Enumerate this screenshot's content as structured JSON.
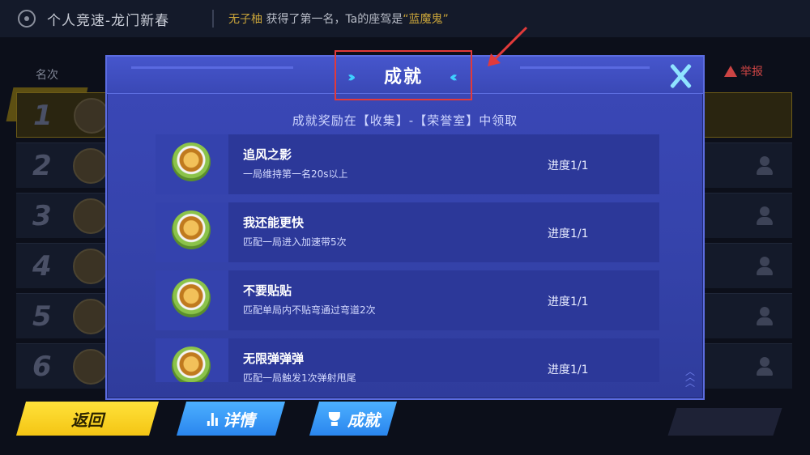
{
  "topbar": {
    "mode_title": "个人竞速-龙门新春",
    "broadcast_player": "无子柚",
    "broadcast_mid": "获得了第一名，Ta的座驾是",
    "broadcast_car": "“蓝魔鬼”"
  },
  "scoreboard": {
    "rank_header": "名次",
    "report_label": "举报",
    "rows": [
      {
        "rank": "1"
      },
      {
        "rank": "2"
      },
      {
        "rank": "3"
      },
      {
        "rank": "4"
      },
      {
        "rank": "5"
      },
      {
        "rank": "6"
      }
    ]
  },
  "dialog": {
    "title": "成就",
    "hint": "成就奖励在【收集】-【荣誉室】中领取",
    "achievements": [
      {
        "name": "追风之影",
        "desc": "一局维持第一名20s以上",
        "progress": "进度1/1",
        "icon": "speed-medal-icon"
      },
      {
        "name": "我还能更快",
        "desc": "匹配一局进入加速带5次",
        "progress": "进度1/1",
        "icon": "chevron-rank-medal-icon"
      },
      {
        "name": "不要贴贴",
        "desc": "匹配单局内不贴弯通过弯道2次",
        "progress": "进度1/1",
        "icon": "car-medal-icon"
      },
      {
        "name": "无限弹弹弹",
        "desc": "匹配一局触发1次弹射甩尾",
        "progress": "进度1/1",
        "icon": "tank-medal-icon"
      }
    ]
  },
  "buttons": {
    "back": "返回",
    "details": "详情",
    "achievements": "成就"
  },
  "colors": {
    "dialog_bg": "#3543ab",
    "accent_cyan": "#3fd0ff",
    "back_button": "#f4c514",
    "blue_button": "#2a86ee",
    "annotation_red": "#e23a3a"
  }
}
